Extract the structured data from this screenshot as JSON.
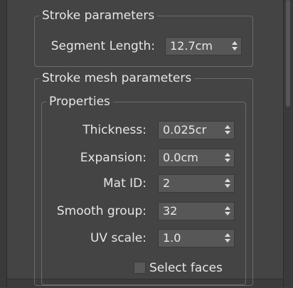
{
  "stroke_parameters": {
    "title": "Stroke parameters",
    "segment_length": {
      "label": "Segment Length:",
      "value": "12.7cm"
    }
  },
  "stroke_mesh_parameters": {
    "title": "Stroke mesh parameters",
    "properties": {
      "title": "Properties",
      "fields": [
        {
          "label": "Thickness:",
          "value": "0.025cr"
        },
        {
          "label": "Expansion:",
          "value": "0.0cm"
        },
        {
          "label": "Mat ID:",
          "value": "2"
        },
        {
          "label": "Smooth group:",
          "value": "32"
        },
        {
          "label": "UV scale:",
          "value": "1.0"
        }
      ],
      "select_faces": {
        "label": "Select faces",
        "checked": false
      }
    }
  }
}
